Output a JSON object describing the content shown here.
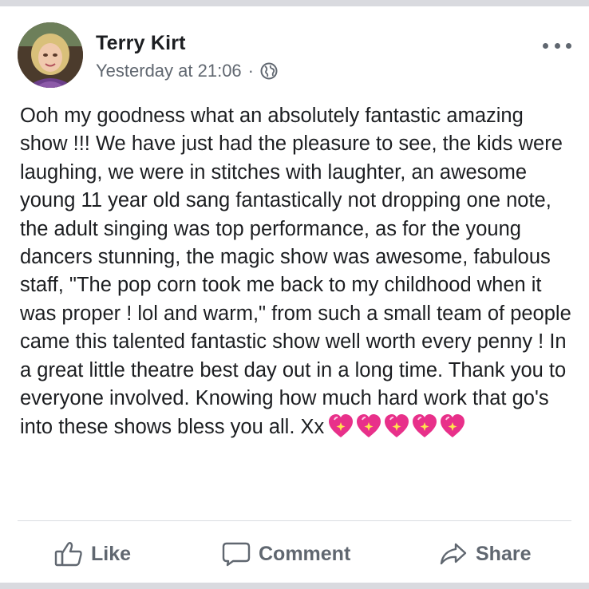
{
  "post": {
    "author": "Terry Kirt",
    "timestamp": "Yesterday at 21:06",
    "separator": "·",
    "privacy_icon": "globe-icon",
    "more_icon": "more-horizontal-icon",
    "body": "Ooh my goodness what an absolutely fantastic amazing show !!! We have just had the pleasure to see, the kids were laughing, we were in stitches with laughter, an  awesome young 11 year old sang fantastically not dropping one note, the adult singing was top performance,  as for the young dancers stunning, the magic show was awesome,  fabulous staff,  \"The pop corn took me back to my childhood when it was proper ! lol and warm,\"  from such a small team of people came this talented fantastic show well worth every penny ! In a great little theatre best day out in a long time. Thank you to everyone involved. Knowing how much hard work that go's into these shows bless you all. Xx",
    "emoji": [
      "sparkling-heart-icon",
      "sparkling-heart-icon",
      "sparkling-heart-icon",
      "sparkling-heart-icon",
      "sparkling-heart-icon"
    ]
  },
  "actions": {
    "like": "Like",
    "comment": "Comment",
    "share": "Share"
  },
  "colors": {
    "text": "#1c1e21",
    "secondary": "#606770",
    "heart": "#e8308a",
    "band": "#d9dadf"
  }
}
